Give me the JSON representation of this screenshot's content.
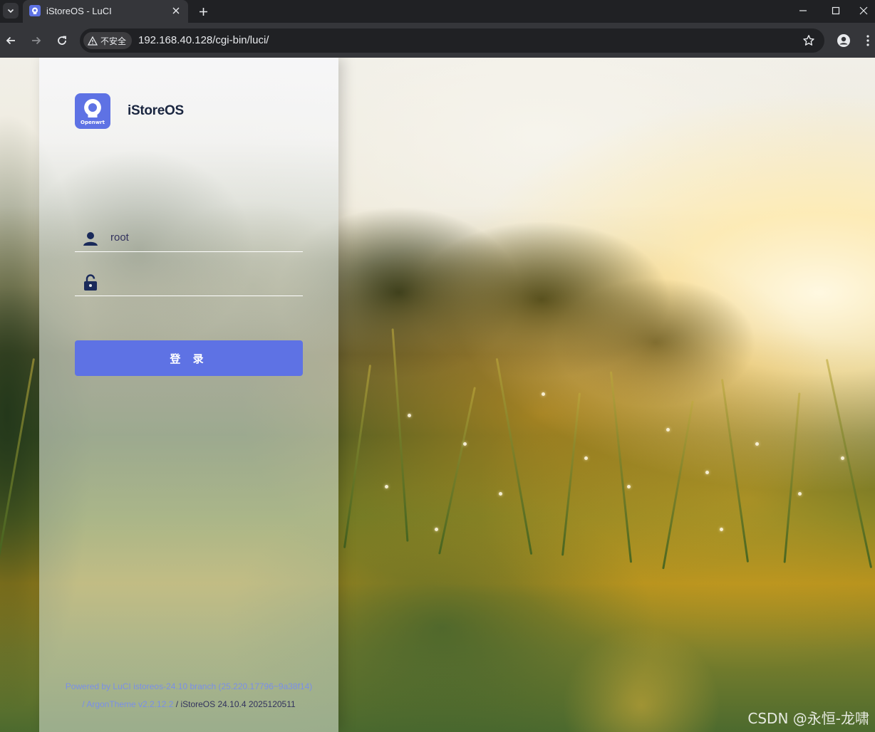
{
  "browser": {
    "tab_title": "iStoreOS - LuCI",
    "security_label": "不安全",
    "url": "192.168.40.128/cgi-bin/luci/"
  },
  "login": {
    "brand": "iStoreOS",
    "logo_caption": "Openwrt",
    "username_value": "root",
    "password_value": "",
    "login_button": "登 录",
    "footer": {
      "powered_by": "Powered by LuCI istoreos-24.10 branch (25.220.17796~9a38f14)",
      "sep1": "/",
      "theme_link": "ArgonTheme v2.2.12.2",
      "sep2": "/",
      "version": "iStoreOS 24.10.4 2025120511"
    }
  },
  "watermark": "CSDN @永恒-龙啸",
  "colors": {
    "accent": "#5e72e4",
    "chrome_dark": "#202124",
    "chrome_toolbar": "#35363a"
  }
}
